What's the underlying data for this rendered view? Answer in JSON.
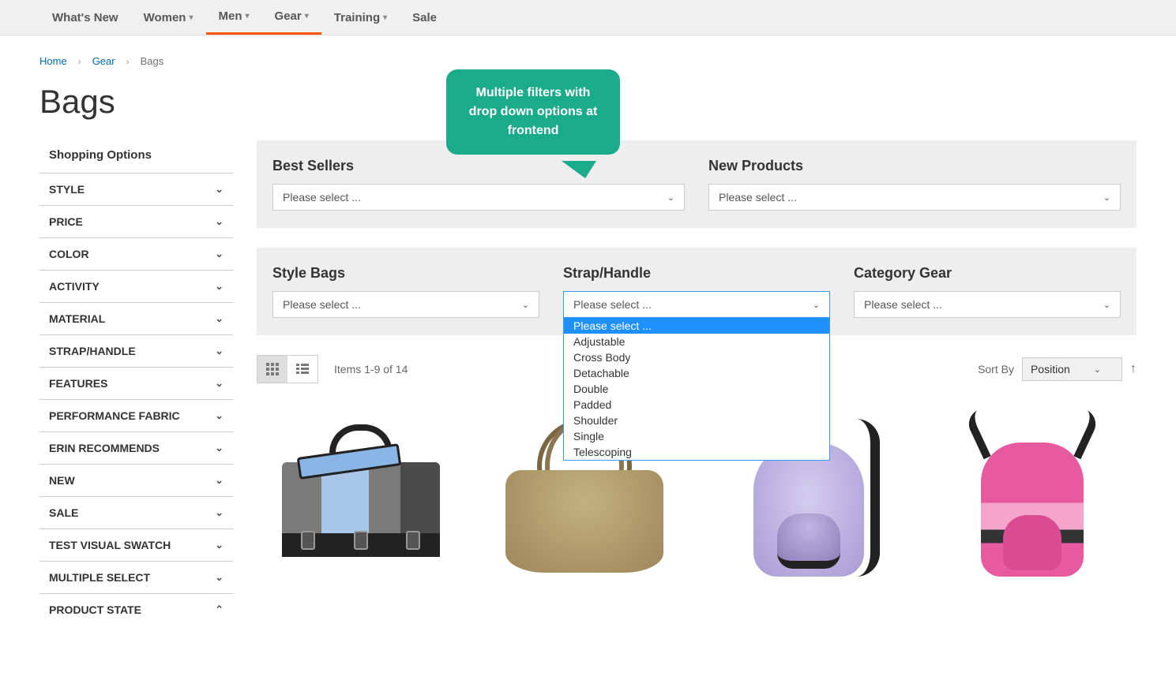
{
  "nav": {
    "items": [
      {
        "label": "What's New",
        "has_dropdown": false
      },
      {
        "label": "Women",
        "has_dropdown": true
      },
      {
        "label": "Men",
        "has_dropdown": true,
        "active": true
      },
      {
        "label": "Gear",
        "has_dropdown": true,
        "active": true
      },
      {
        "label": "Training",
        "has_dropdown": true
      },
      {
        "label": "Sale",
        "has_dropdown": false
      }
    ]
  },
  "breadcrumb": {
    "home": "Home",
    "gear": "Gear",
    "current": "Bags"
  },
  "page_title": "Bags",
  "sidebar": {
    "heading": "Shopping Options",
    "filters": [
      "Style",
      "Price",
      "Color",
      "Activity",
      "Material",
      "Strap/Handle",
      "Features",
      "Performance Fabric",
      "Erin Recommends",
      "New",
      "Sale",
      "Test Visual Swatch",
      "Multiple Select",
      "Product State"
    ]
  },
  "filter_groups": {
    "placeholder": "Please select ...",
    "group1": [
      {
        "label": "Best Sellers"
      },
      {
        "label": "New Products"
      }
    ],
    "group2": [
      {
        "label": "Style Bags"
      },
      {
        "label": "Strap/Handle",
        "open": true
      },
      {
        "label": "Category Gear"
      }
    ],
    "strap_handle_options": [
      "Please select ...",
      "Adjustable",
      "Cross Body",
      "Detachable",
      "Double",
      "Padded",
      "Shoulder",
      "Single",
      "Telescoping"
    ]
  },
  "toolbar": {
    "item_count": "Items 1-9 of 14",
    "sort_label": "Sort By",
    "sort_value": "Position"
  },
  "callout": {
    "text": "Multiple filters with drop down options at frontend"
  }
}
